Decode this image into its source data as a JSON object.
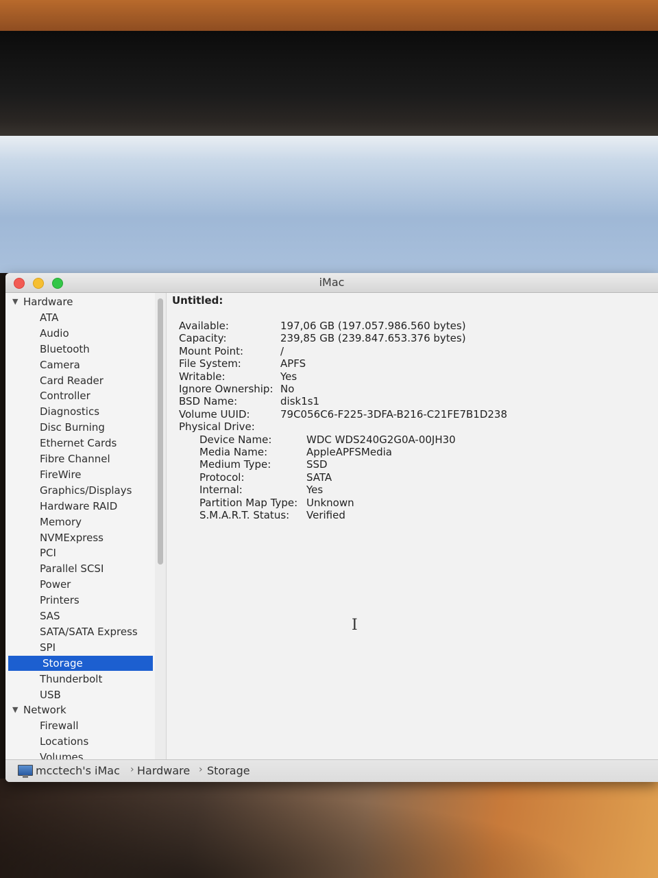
{
  "window": {
    "title": "iMac"
  },
  "sidebar": {
    "hardware_label": "Hardware",
    "hardware_items": [
      "ATA",
      "Audio",
      "Bluetooth",
      "Camera",
      "Card Reader",
      "Controller",
      "Diagnostics",
      "Disc Burning",
      "Ethernet Cards",
      "Fibre Channel",
      "FireWire",
      "Graphics/Displays",
      "Hardware RAID",
      "Memory",
      "NVMExpress",
      "PCI",
      "Parallel SCSI",
      "Power",
      "Printers",
      "SAS",
      "SATA/SATA Express",
      "SPI",
      "Storage",
      "Thunderbolt",
      "USB"
    ],
    "selected": "Storage",
    "network_label": "Network",
    "network_items": [
      "Firewall",
      "Locations",
      "Volumes"
    ]
  },
  "volume": {
    "title": "Untitled:",
    "properties": [
      {
        "key": "Available:",
        "value": "197,06 GB (197.057.986.560 bytes)"
      },
      {
        "key": "Capacity:",
        "value": "239,85 GB (239.847.653.376 bytes)"
      },
      {
        "key": "Mount Point:",
        "value": "/"
      },
      {
        "key": "File System:",
        "value": "APFS"
      },
      {
        "key": "Writable:",
        "value": "Yes"
      },
      {
        "key": "Ignore Ownership:",
        "value": "No"
      },
      {
        "key": "BSD Name:",
        "value": "disk1s1"
      },
      {
        "key": "Volume UUID:",
        "value": "79C056C6-F225-3DFA-B216-C21FE7B1D238"
      },
      {
        "key": "Physical Drive:",
        "value": ""
      }
    ],
    "physical_drive": [
      {
        "key": "Device Name:",
        "value": "WDC WDS240G2G0A-00JH30"
      },
      {
        "key": "Media Name:",
        "value": "AppleAPFSMedia"
      },
      {
        "key": "Medium Type:",
        "value": "SSD"
      },
      {
        "key": "Protocol:",
        "value": "SATA"
      },
      {
        "key": "Internal:",
        "value": "Yes"
      },
      {
        "key": "Partition Map Type:",
        "value": "Unknown"
      },
      {
        "key": "S.M.A.R.T. Status:",
        "value": "Verified"
      }
    ]
  },
  "pathbar": {
    "computer": "mcctech's iMac",
    "section": "Hardware",
    "item": "Storage"
  },
  "icons": {
    "computer": "imac-icon",
    "expand": "disclosure-triangle-icon"
  }
}
